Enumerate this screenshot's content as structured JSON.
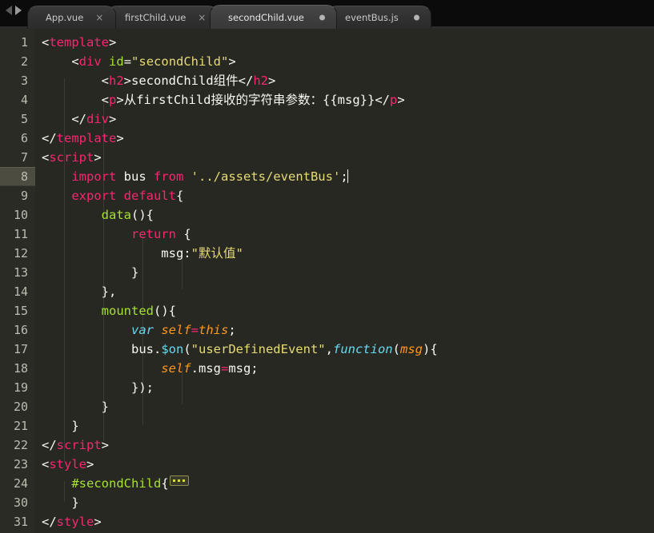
{
  "window": {
    "nav": {
      "back_icon": "arrow-left-icon",
      "forward_icon": "arrow-right-icon"
    }
  },
  "tabs": [
    {
      "label": "App.vue",
      "active": false,
      "indicator": "close-icon",
      "indicator_glyph": "×"
    },
    {
      "label": "firstChild.vue",
      "active": false,
      "indicator": "close-icon",
      "indicator_glyph": "×"
    },
    {
      "label": "secondChild.vue",
      "active": true,
      "indicator": "unsaved-dot-icon",
      "indicator_glyph": ""
    },
    {
      "label": "eventBus.js",
      "active": false,
      "indicator": "unsaved-dot-icon",
      "indicator_glyph": ""
    }
  ],
  "editor": {
    "active_line": 8,
    "gutter_numbers": [
      "1",
      "2",
      "3",
      "4",
      "5",
      "6",
      "7",
      "8",
      "9",
      "10",
      "11",
      "12",
      "13",
      "14",
      "15",
      "16",
      "17",
      "18",
      "19",
      "20",
      "21",
      "22",
      "23",
      "24",
      "30",
      "31"
    ],
    "lines": [
      {
        "num": "1",
        "indent": 0,
        "tokens": [
          {
            "t": "punc",
            "v": "<"
          },
          {
            "t": "tag",
            "v": "template"
          },
          {
            "t": "punc",
            "v": ">"
          }
        ]
      },
      {
        "num": "2",
        "indent": 1,
        "tokens": [
          {
            "t": "punc",
            "v": "    <"
          },
          {
            "t": "tag",
            "v": "div"
          },
          {
            "t": "plain",
            "v": " "
          },
          {
            "t": "attr",
            "v": "id"
          },
          {
            "t": "plain",
            "v": "="
          },
          {
            "t": "str",
            "v": "\"secondChild\""
          },
          {
            "t": "punc",
            "v": ">"
          }
        ]
      },
      {
        "num": "3",
        "indent": 2,
        "tokens": [
          {
            "t": "punc",
            "v": "        <"
          },
          {
            "t": "tag",
            "v": "h2"
          },
          {
            "t": "punc",
            "v": ">"
          },
          {
            "t": "text",
            "v": "secondChild组件"
          },
          {
            "t": "punc",
            "v": "</"
          },
          {
            "t": "tag",
            "v": "h2"
          },
          {
            "t": "punc",
            "v": ">"
          }
        ]
      },
      {
        "num": "4",
        "indent": 2,
        "tokens": [
          {
            "t": "punc",
            "v": "        <"
          },
          {
            "t": "tag",
            "v": "p"
          },
          {
            "t": "punc",
            "v": ">"
          },
          {
            "t": "text",
            "v": "从firstChild接收的字符串参数：{{msg}}"
          },
          {
            "t": "punc",
            "v": "</"
          },
          {
            "t": "tag",
            "v": "p"
          },
          {
            "t": "punc",
            "v": ">"
          }
        ]
      },
      {
        "num": "5",
        "indent": 1,
        "tokens": [
          {
            "t": "punc",
            "v": "    </"
          },
          {
            "t": "tag",
            "v": "div"
          },
          {
            "t": "punc",
            "v": ">"
          }
        ]
      },
      {
        "num": "6",
        "indent": 0,
        "tokens": [
          {
            "t": "punc",
            "v": "</"
          },
          {
            "t": "tag",
            "v": "template"
          },
          {
            "t": "punc",
            "v": ">"
          }
        ]
      },
      {
        "num": "7",
        "indent": 0,
        "tokens": [
          {
            "t": "punc",
            "v": "<"
          },
          {
            "t": "tag",
            "v": "script"
          },
          {
            "t": "punc",
            "v": ">"
          }
        ]
      },
      {
        "num": "8",
        "indent": 1,
        "active": true,
        "tokens": [
          {
            "t": "kw",
            "v": "    import"
          },
          {
            "t": "plain",
            "v": " bus "
          },
          {
            "t": "kw",
            "v": "from"
          },
          {
            "t": "plain",
            "v": " "
          },
          {
            "t": "str",
            "v": "'../assets/eventBus'"
          },
          {
            "t": "plain",
            "v": ";"
          },
          {
            "t": "cursor",
            "v": ""
          }
        ]
      },
      {
        "num": "9",
        "indent": 1,
        "tokens": [
          {
            "t": "kw",
            "v": "    export default"
          },
          {
            "t": "plain",
            "v": "{"
          }
        ]
      },
      {
        "num": "10",
        "indent": 2,
        "tokens": [
          {
            "t": "fn",
            "v": "        data"
          },
          {
            "t": "plain",
            "v": "(){"
          }
        ]
      },
      {
        "num": "11",
        "indent": 3,
        "tokens": [
          {
            "t": "kw",
            "v": "            return"
          },
          {
            "t": "plain",
            "v": " {"
          }
        ]
      },
      {
        "num": "12",
        "indent": 4,
        "tokens": [
          {
            "t": "plain",
            "v": "                msg:"
          },
          {
            "t": "str",
            "v": "\"默认值\""
          }
        ]
      },
      {
        "num": "13",
        "indent": 3,
        "tokens": [
          {
            "t": "plain",
            "v": "            }"
          }
        ]
      },
      {
        "num": "14",
        "indent": 2,
        "tokens": [
          {
            "t": "plain",
            "v": "        },"
          }
        ]
      },
      {
        "num": "15",
        "indent": 2,
        "tokens": [
          {
            "t": "fn",
            "v": "        mounted"
          },
          {
            "t": "plain",
            "v": "(){"
          }
        ]
      },
      {
        "num": "16",
        "indent": 3,
        "tokens": [
          {
            "t": "cyan",
            "v": "            var"
          },
          {
            "t": "plain",
            "v": " "
          },
          {
            "t": "param",
            "v": "self"
          },
          {
            "t": "op",
            "v": "="
          },
          {
            "t": "param",
            "v": "this"
          },
          {
            "t": "plain",
            "v": ";"
          }
        ]
      },
      {
        "num": "17",
        "indent": 3,
        "tokens": [
          {
            "t": "plain",
            "v": "            bus."
          },
          {
            "t": "method",
            "v": "$on"
          },
          {
            "t": "plain",
            "v": "("
          },
          {
            "t": "str",
            "v": "\"userDefinedEvent\""
          },
          {
            "t": "plain",
            "v": ","
          },
          {
            "t": "cyan",
            "v": "function"
          },
          {
            "t": "plain",
            "v": "("
          },
          {
            "t": "param",
            "v": "msg"
          },
          {
            "t": "plain",
            "v": "){"
          }
        ]
      },
      {
        "num": "18",
        "indent": 4,
        "tokens": [
          {
            "t": "param",
            "v": "                self"
          },
          {
            "t": "plain",
            "v": ".msg"
          },
          {
            "t": "op",
            "v": "="
          },
          {
            "t": "plain",
            "v": "msg;"
          }
        ]
      },
      {
        "num": "19",
        "indent": 3,
        "tokens": [
          {
            "t": "plain",
            "v": "            });"
          }
        ]
      },
      {
        "num": "20",
        "indent": 2,
        "tokens": [
          {
            "t": "plain",
            "v": "        }"
          }
        ]
      },
      {
        "num": "21",
        "indent": 1,
        "tokens": [
          {
            "t": "plain",
            "v": "    }"
          }
        ]
      },
      {
        "num": "22",
        "indent": 0,
        "tokens": [
          {
            "t": "punc",
            "v": "</"
          },
          {
            "t": "tag",
            "v": "script"
          },
          {
            "t": "punc",
            "v": ">"
          }
        ]
      },
      {
        "num": "23",
        "indent": 0,
        "tokens": [
          {
            "t": "punc",
            "v": "<"
          },
          {
            "t": "tag",
            "v": "style"
          },
          {
            "t": "punc",
            "v": ">"
          }
        ]
      },
      {
        "num": "24",
        "indent": 1,
        "tokens": [
          {
            "t": "attr",
            "v": "    #secondChild"
          },
          {
            "t": "plain",
            "v": "{"
          },
          {
            "t": "fold",
            "v": ""
          }
        ]
      },
      {
        "num": "30",
        "indent": 1,
        "tokens": [
          {
            "t": "plain",
            "v": "    }"
          }
        ]
      },
      {
        "num": "31",
        "indent": 0,
        "tokens": [
          {
            "t": "punc",
            "v": "</"
          },
          {
            "t": "tag",
            "v": "style"
          },
          {
            "t": "punc",
            "v": ">"
          }
        ]
      }
    ]
  },
  "colors": {
    "editor_bg": "#272822",
    "gutter_bg": "#2b2b26",
    "active_line_gutter": "#4c4c40",
    "tag": "#f92672",
    "attr": "#a6e22e",
    "string": "#e6db74",
    "keyword": "#f92672",
    "function": "#a6e22e",
    "cyan": "#66d9ef",
    "param": "#fd971f",
    "plain": "#f8f8f2",
    "tabbar_bg": "#0b0b0b"
  }
}
